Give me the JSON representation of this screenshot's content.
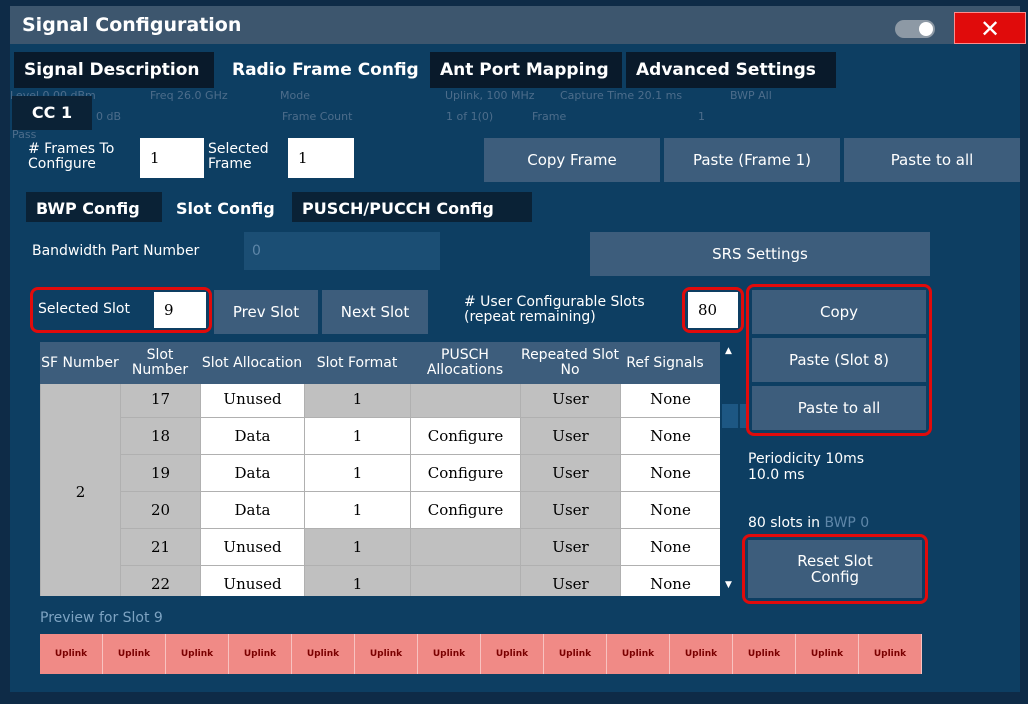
{
  "window": {
    "title": "Signal Configuration"
  },
  "outer_tabs": [
    "Signal Description",
    "Radio Frame Config",
    "Ant Port Mapping",
    "Advanced Settings"
  ],
  "background_text": {
    "ref_level": "Level 0.00 dBm",
    "freq": "Freq 26.0 GHz",
    "mode": "Mode",
    "uplink": "Uplink, 100 MHz",
    "capture": "Capture Time 20.1 ms",
    "bwp": "BWP All",
    "att": "0 dB",
    "frame_count": "Frame Count",
    "frame_count_val": "1 of 1(0)",
    "frame": "Frame",
    "frame_val": "1",
    "pass": "Pass"
  },
  "cc_tab": "CC 1",
  "frames": {
    "frames_label": "# Frames To Configure",
    "frames_value": "1",
    "selected_frame_label": "Selected Frame",
    "selected_frame_value": "1",
    "copy_frame": "Copy Frame",
    "paste_frame": "Paste (Frame 1)",
    "paste_all": "Paste to all"
  },
  "inner_tabs": [
    "BWP Config",
    "Slot Config",
    "PUSCH/PUCCH Config"
  ],
  "bwp": {
    "label": "Bandwidth Part Number",
    "value": "0"
  },
  "srs_settings": "SRS Settings",
  "slot_nav": {
    "selected_slot_label": "Selected Slot",
    "selected_slot_value": "9",
    "prev": "Prev Slot",
    "next": "Next Slot",
    "user_slots_label": "# User Configurable Slots (repeat remaining)",
    "user_slots_value": "80"
  },
  "side_buttons": {
    "copy": "Copy",
    "paste_slot": "Paste (Slot 8)",
    "paste_all": "Paste to all",
    "periodicity": "Periodicity 10ms",
    "periodicity_value": "10.0 ms",
    "slots_in": "80 slots in",
    "slots_bwp": "BWP 0",
    "reset": "Reset Slot Config"
  },
  "table": {
    "headers": [
      "SF Number",
      "Slot Number",
      "Slot Allocation",
      "Slot Format",
      "PUSCH Allocations",
      "Repeated Slot No",
      "Ref Signals"
    ],
    "sf_value": "2",
    "rows": [
      {
        "slot": "17",
        "alloc": "Unused",
        "format": "1",
        "pusch": "",
        "repeated": "User",
        "ref": "None"
      },
      {
        "slot": "18",
        "alloc": "Data",
        "format": "1",
        "pusch": "Configure",
        "repeated": "User",
        "ref": "None"
      },
      {
        "slot": "19",
        "alloc": "Data",
        "format": "1",
        "pusch": "Configure",
        "repeated": "User",
        "ref": "None"
      },
      {
        "slot": "20",
        "alloc": "Data",
        "format": "1",
        "pusch": "Configure",
        "repeated": "User",
        "ref": "None"
      },
      {
        "slot": "21",
        "alloc": "Unused",
        "format": "1",
        "pusch": "",
        "repeated": "User",
        "ref": "None"
      },
      {
        "slot": "22",
        "alloc": "Unused",
        "format": "1",
        "pusch": "",
        "repeated": "User",
        "ref": "None"
      }
    ]
  },
  "preview": {
    "label": "Preview for Slot 9",
    "cells": [
      "Uplink",
      "Uplink",
      "Uplink",
      "Uplink",
      "Uplink",
      "Uplink",
      "Uplink",
      "Uplink",
      "Uplink",
      "Uplink",
      "Uplink",
      "Uplink",
      "Uplink",
      "Uplink"
    ]
  },
  "icons": {
    "close": "close-icon",
    "toggle": "toggle-icon",
    "scroll_up": "scroll-up-icon",
    "scroll_down": "scroll-down-icon"
  },
  "colors": {
    "highlight": "#e00b0b",
    "panel": "#0d3e62",
    "button": "#3d5d7c",
    "uplink": "#f08a86"
  }
}
